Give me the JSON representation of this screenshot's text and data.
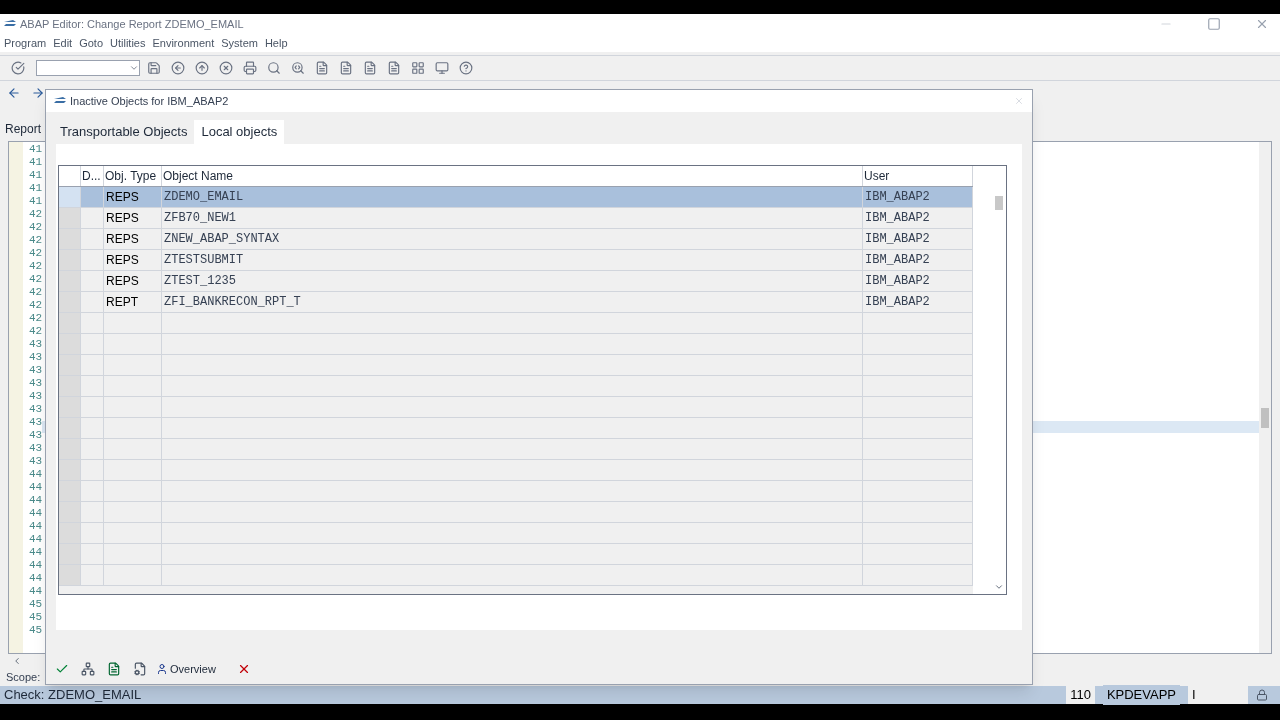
{
  "window": {
    "title": "ABAP Editor: Change Report ZDEMO_EMAIL"
  },
  "menu": [
    "Program",
    "Edit",
    "Goto",
    "Utilities",
    "Environment",
    "System",
    "Help"
  ],
  "screen_title": "Report",
  "line_numbers": [
    "41",
    "41",
    "41",
    "41",
    "41",
    "42",
    "42",
    "42",
    "42",
    "42",
    "42",
    "42",
    "42",
    "42",
    "42",
    "43",
    "43",
    "43",
    "43",
    "43",
    "43",
    "43",
    "43",
    "43",
    "43",
    "44",
    "44",
    "44",
    "44",
    "44",
    "44",
    "44",
    "44",
    "44",
    "44",
    "45",
    "45",
    "45"
  ],
  "scope_label": "Scope:",
  "status_bar": {
    "message": "Check: ZDEMO_EMAIL",
    "client": "110",
    "server": "KPDEVAPP",
    "mode": "I"
  },
  "dialog": {
    "title": "Inactive Objects for IBM_ABAP2",
    "tabs": [
      {
        "label": "Transportable Objects",
        "selected": false
      },
      {
        "label": "Local objects",
        "selected": true
      }
    ],
    "table": {
      "columns": [
        "D...",
        "Obj. Type",
        "Object Name",
        "User"
      ],
      "rows": [
        {
          "type": "REPS",
          "name": "ZDEMO_EMAIL",
          "user": "IBM_ABAP2",
          "selected": true
        },
        {
          "type": "REPS",
          "name": "ZFB70_NEW1",
          "user": "IBM_ABAP2",
          "selected": false
        },
        {
          "type": "REPS",
          "name": "ZNEW_ABAP_SYNTAX",
          "user": "IBM_ABAP2",
          "selected": false
        },
        {
          "type": "REPS",
          "name": "ZTESTSUBMIT",
          "user": "IBM_ABAP2",
          "selected": false
        },
        {
          "type": "REPS",
          "name": "ZTEST_1235",
          "user": "IBM_ABAP2",
          "selected": false
        },
        {
          "type": "REPT",
          "name": "ZFI_BANKRECON_RPT_T",
          "user": "IBM_ABAP2",
          "selected": false
        }
      ]
    },
    "overview_button": "Overview"
  }
}
